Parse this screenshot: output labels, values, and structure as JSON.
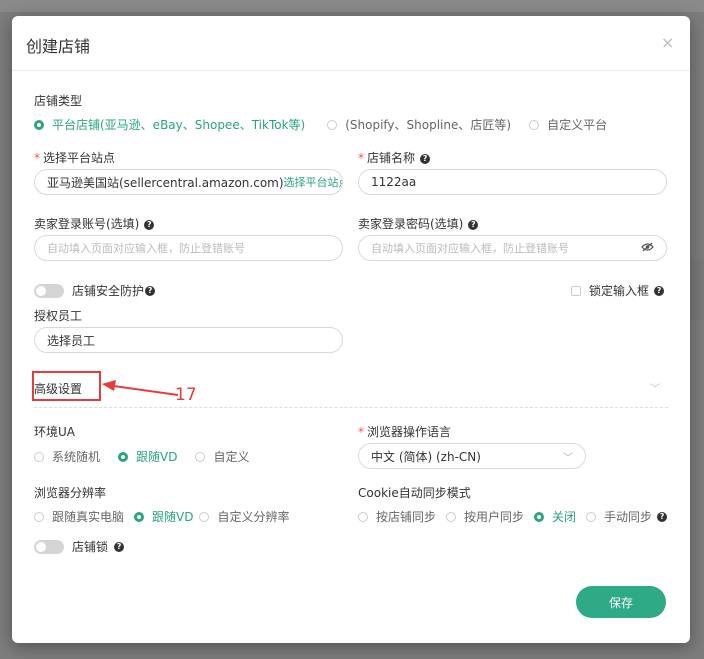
{
  "modal": {
    "title": "创建店铺",
    "close_glyph": "×"
  },
  "shop_type": {
    "label": "店铺类型",
    "options": [
      "平台店铺(亚马逊、eBay、Shopee、TikTok等)",
      "(Shopify、Shopline、店匠等)",
      "自定义平台"
    ],
    "selected": 0
  },
  "platform_site": {
    "label": "选择平台站点",
    "value": "亚马逊美国站(sellercentral.amazon.com)",
    "link": "选择平台站点"
  },
  "shop_name": {
    "label": "店铺名称",
    "value": "1122aa"
  },
  "seller_account": {
    "label": "卖家登录账号(选填)",
    "placeholder": "自动填入页面对应输入框，防止登错账号"
  },
  "seller_password": {
    "label": "卖家登录密码(选填)",
    "placeholder": "自动填入页面对应输入框，防止登错账号"
  },
  "security": {
    "label": "店铺安全防护",
    "lock_input_label": "锁定输入框"
  },
  "staff": {
    "label": "授权员工",
    "value": "选择员工"
  },
  "advanced": {
    "label": "高级设置",
    "annotation": "17"
  },
  "env_ua": {
    "label": "环境UA",
    "options": [
      "系统随机",
      "跟随VD",
      "自定义"
    ],
    "selected": 1
  },
  "browser_lang": {
    "label": "浏览器操作语言",
    "value": "中文 (简体) (zh-CN)"
  },
  "resolution": {
    "label": "浏览器分辨率",
    "options": [
      "跟随真实电脑",
      "跟随VD",
      "自定义分辨率"
    ],
    "selected": 1
  },
  "cookie_sync": {
    "label": "Cookie自动同步模式",
    "options": [
      "按店铺同步",
      "按用户同步",
      "关闭",
      "手动同步"
    ],
    "selected": 2
  },
  "shop_lock": {
    "label": "店铺锁"
  },
  "footer": {
    "save": "保存"
  },
  "colors": {
    "accent": "#2eaa86",
    "required": "#ff4d4f",
    "annotation": "#e83b3b"
  }
}
